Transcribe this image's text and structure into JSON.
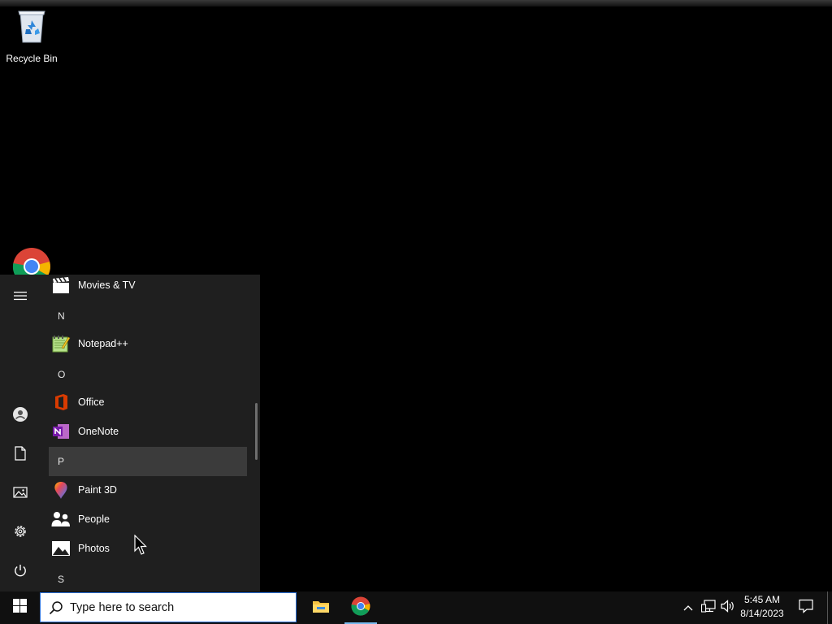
{
  "desktop": {
    "icons": [
      {
        "label": "Recycle Bin",
        "icon": "recycle-bin-icon"
      },
      {
        "label": "",
        "icon": "chrome-icon"
      }
    ]
  },
  "start_menu": {
    "rail": [
      {
        "icon": "hamburger-menu-icon"
      },
      {
        "icon": "user-account-icon"
      },
      {
        "icon": "documents-icon"
      },
      {
        "icon": "pictures-icon"
      },
      {
        "icon": "settings-gear-icon"
      },
      {
        "icon": "power-icon"
      }
    ],
    "items": [
      {
        "type": "app",
        "label": "Movies & TV",
        "icon": "movies-tv-icon"
      },
      {
        "type": "letter",
        "label": "N"
      },
      {
        "type": "app",
        "label": "Notepad++",
        "icon": "notepad-plus-plus-icon"
      },
      {
        "type": "letter",
        "label": "O"
      },
      {
        "type": "app",
        "label": "Office",
        "icon": "office-icon"
      },
      {
        "type": "app",
        "label": "OneNote",
        "icon": "onenote-icon"
      },
      {
        "type": "letter",
        "label": "P"
      },
      {
        "type": "app",
        "label": "Paint 3D",
        "icon": "paint-3d-icon"
      },
      {
        "type": "app",
        "label": "People",
        "icon": "people-icon"
      },
      {
        "type": "app",
        "label": "Photos",
        "icon": "photos-icon"
      },
      {
        "type": "letter",
        "label": "S"
      }
    ]
  },
  "taskbar": {
    "search_placeholder": "Type here to search",
    "pinned": [
      {
        "icon": "file-explorer-icon"
      },
      {
        "icon": "chrome-icon"
      }
    ],
    "tray": [
      {
        "icon": "show-hidden-icons-chevron-icon"
      },
      {
        "icon": "network-icon"
      },
      {
        "icon": "volume-icon"
      }
    ],
    "time": "5:45 AM",
    "date": "8/14/2023",
    "notifications_icon": "action-center-icon"
  },
  "colors": {
    "desktop_bg": "#000000",
    "start_menu_bg": "#1f1f1f",
    "taskbar_bg": "#101010",
    "search_border": "#2b6fd6",
    "active_indicator": "#76b9ed"
  }
}
